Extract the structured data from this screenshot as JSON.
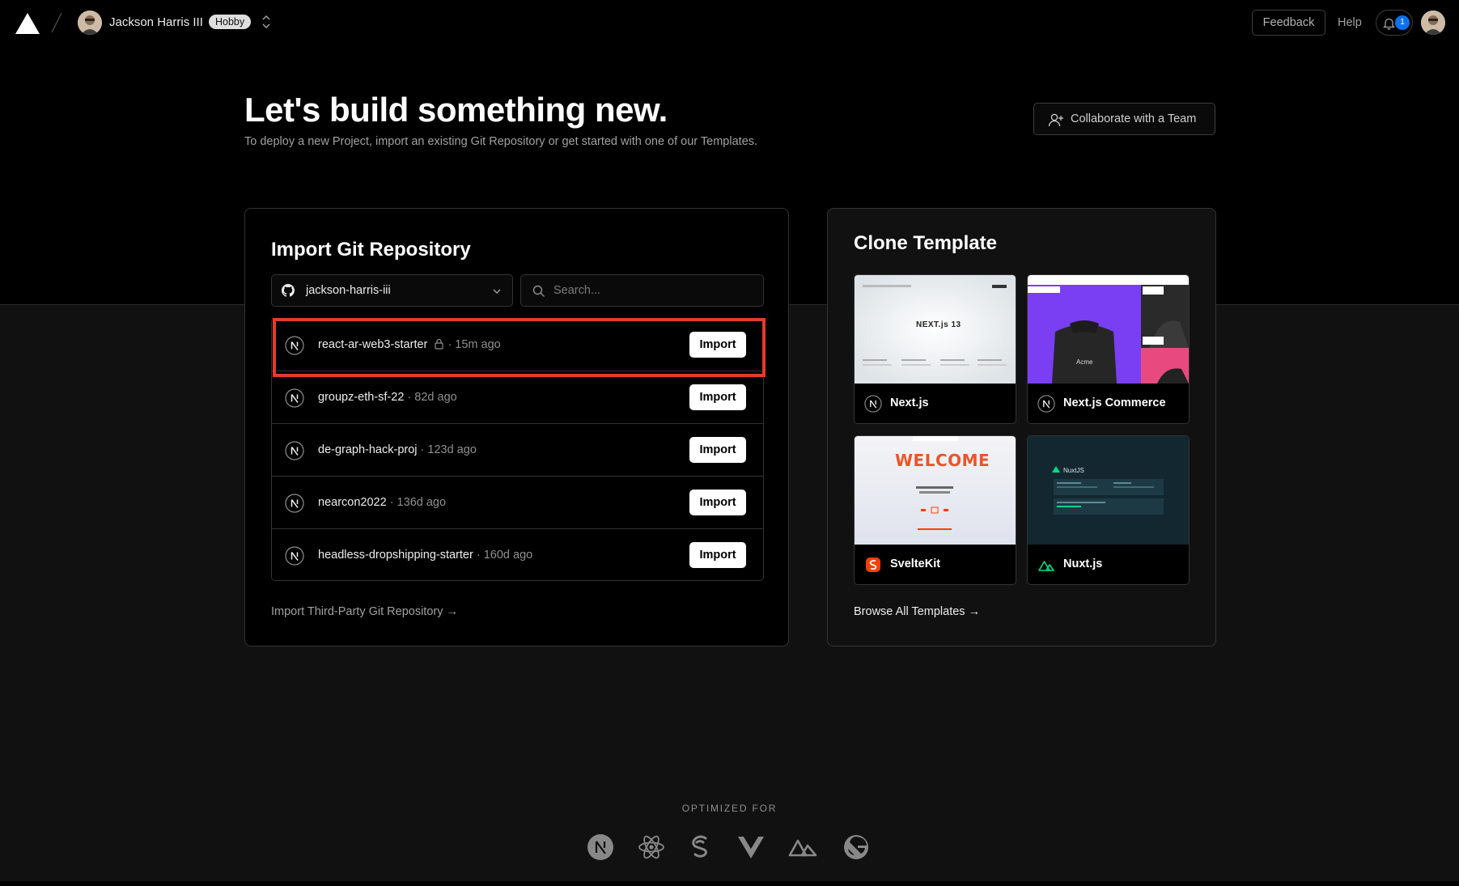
{
  "header": {
    "user_name": "Jackson Harris III",
    "plan_badge": "Hobby",
    "feedback_label": "Feedback",
    "help_label": "Help",
    "notification_count": "1"
  },
  "hero": {
    "title": "Let's build something new.",
    "subtitle": "To deploy a new Project, import an existing Git Repository or get started with one of our Templates.",
    "collaborate_label": "Collaborate with a Team"
  },
  "import": {
    "title": "Import Git Repository",
    "account": "jackson-harris-iii",
    "search_placeholder": "Search...",
    "repos": [
      {
        "name": "react-ar-web3-starter",
        "meta": "· 15m ago",
        "private": true,
        "button": "Import"
      },
      {
        "name": "groupz-eth-sf-22",
        "meta": "· 82d ago",
        "private": false,
        "button": "Import"
      },
      {
        "name": "de-graph-hack-proj",
        "meta": "· 123d ago",
        "private": false,
        "button": "Import"
      },
      {
        "name": "nearcon2022",
        "meta": "· 136d ago",
        "private": false,
        "button": "Import"
      },
      {
        "name": "headless-dropshipping-starter",
        "meta": "· 160d ago",
        "private": false,
        "button": "Import"
      }
    ],
    "third_party_link": "Import Third-Party Git Repository →"
  },
  "clone": {
    "title": "Clone Template",
    "templates": [
      {
        "name": "Next.js",
        "icon": "nextjs-icon"
      },
      {
        "name": "Next.js Commerce",
        "icon": "nextjs-icon"
      },
      {
        "name": "SvelteKit",
        "icon": "svelte-icon"
      },
      {
        "name": "Nuxt.js",
        "icon": "nuxt-icon"
      }
    ],
    "thumb_text": {
      "nextjs": "NEXT.js 13",
      "commerce": "Acme",
      "svelte": "WELCOME",
      "nuxt": "NuxtJS"
    },
    "browse_all": "Browse All Templates →"
  },
  "footer": {
    "optimized_for": "OPTIMIZED FOR",
    "frameworks": [
      "nextjs-icon",
      "react-icon",
      "svelte-icon",
      "vue-icon",
      "nuxt-icon",
      "gatsby-icon"
    ]
  },
  "colors": {
    "background": "#000000",
    "lower_background": "#111111",
    "highlight": "#e53a2c",
    "notification": "#0a72ef"
  }
}
